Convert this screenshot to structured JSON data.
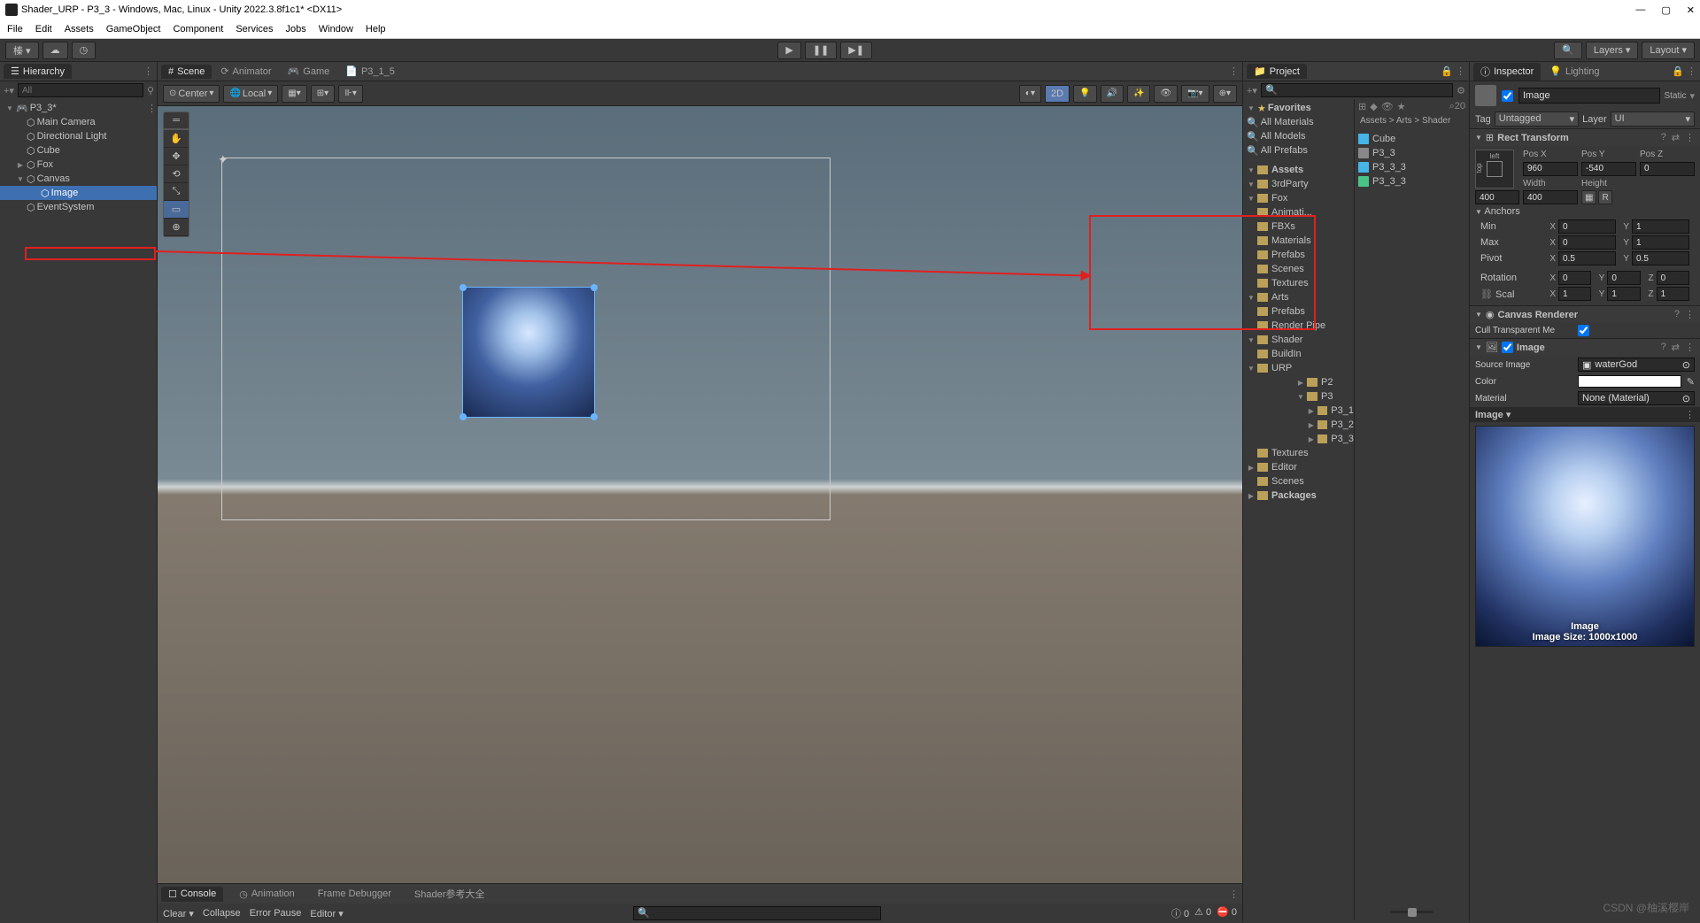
{
  "window": {
    "title": "Shader_URP - P3_3 - Windows, Mac, Linux - Unity 2022.3.8f1c1* <DX11>",
    "min": "—",
    "max": "▢",
    "close": "✕"
  },
  "menu": [
    "File",
    "Edit",
    "Assets",
    "GameObject",
    "Component",
    "Services",
    "Jobs",
    "Window",
    "Help"
  ],
  "toolbar": {
    "account": "榛 ▾",
    "layers": "Layers",
    "layout": "Layout"
  },
  "hierarchy": {
    "title": "Hierarchy",
    "search_placeholder": "All",
    "root": "P3_3*",
    "items": [
      "Main Camera",
      "Directional Light",
      "Cube",
      "Fox",
      "Canvas",
      "Image",
      "EventSystem"
    ]
  },
  "scene": {
    "tabs": {
      "scene": "Scene",
      "animator": "Animator",
      "game": "Game",
      "p315": "P3_1_5"
    },
    "pivot": "Center",
    "space": "Local",
    "mode2d": "2D"
  },
  "console": {
    "tabs": {
      "console": "Console",
      "animation": "Animation",
      "frame": "Frame Debugger",
      "shader": "Shader参考大全"
    },
    "clear": "Clear",
    "collapse": "Collapse",
    "errpause": "Error Pause",
    "editor": "Editor",
    "count_info": "0",
    "count_warn": "0",
    "count_err": "0"
  },
  "project": {
    "title": "Project",
    "favorites": "Favorites",
    "fav_items": [
      "All Materials",
      "All Models",
      "All Prefabs"
    ],
    "assets": "Assets",
    "tree": [
      "3rdParty",
      "Fox",
      "Animati...",
      "FBXs",
      "Materials",
      "Prefabs",
      "Scenes",
      "Textures",
      "Arts",
      "Prefabs",
      "Render Pipe",
      "Shader",
      "BuildIn",
      "URP",
      "P2",
      "P3",
      "P3_1",
      "P3_2",
      "P3_3",
      "Textures",
      "Editor",
      "Scenes",
      "Packages"
    ],
    "crumb": "Assets > Arts > Shader",
    "content": [
      "Cube",
      "P3_3",
      "P3_3_3",
      "P3_3_3"
    ]
  },
  "inspector": {
    "title": "Inspector",
    "lighting": "Lighting",
    "name": "Image",
    "static": "Static",
    "tag_lbl": "Tag",
    "tag_val": "Untagged",
    "layer_lbl": "Layer",
    "layer_val": "UI",
    "rect": {
      "title": "Rect Transform",
      "preset_left": "left",
      "preset_top": "top",
      "posx_lbl": "Pos X",
      "posy_lbl": "Pos Y",
      "posz_lbl": "Pos Z",
      "posx": "960",
      "posy": "-540",
      "posz": "0",
      "width_lbl": "Width",
      "height_lbl": "Height",
      "width": "400",
      "height": "400",
      "anchors": "Anchors",
      "min": "Min",
      "max": "Max",
      "min_x": "0",
      "min_y": "1",
      "max_x": "0",
      "max_y": "1",
      "pivot": "Pivot",
      "pivot_x": "0.5",
      "pivot_y": "0.5",
      "rotation": "Rotation",
      "rot_x": "0",
      "rot_y": "0",
      "rot_z": "0",
      "scale": "Scal",
      "scl_x": "1",
      "scl_y": "1",
      "scl_z": "1"
    },
    "canvas_renderer": {
      "title": "Canvas Renderer",
      "cull": "Cull Transparent Me"
    },
    "image": {
      "title": "Image",
      "src_lbl": "Source Image",
      "src_val": "waterGod",
      "color_lbl": "Color",
      "mat_lbl": "Material",
      "mat_val": "None (Material)",
      "sect": "Image",
      "preview_title": "Image",
      "preview_size": "Image Size: 1000x1000"
    }
  },
  "watermark": "CSDN @柚溪樱岸"
}
